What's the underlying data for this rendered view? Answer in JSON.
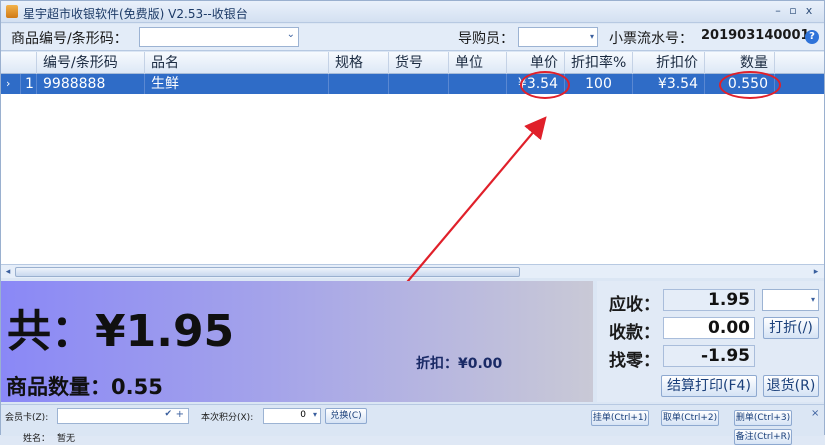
{
  "window": {
    "title": "星宇超市收银软件(免费版) V2.53--收银台",
    "controls": [
      "–",
      "▫",
      "x"
    ]
  },
  "toolbar": {
    "barcode_label": "商品编号/条形码：",
    "barcode_value": "",
    "salesperson_label": "导购员：",
    "salesperson_value": "",
    "receipt_label": "小票流水号：",
    "receipt_no": "201903140001",
    "help_icon": "?"
  },
  "grid": {
    "columns": [
      "编号/条形码",
      "品名",
      "规格",
      "货号",
      "单位",
      "单价",
      "折扣率%",
      "折扣价",
      "数量"
    ],
    "rows": [
      {
        "index": "1",
        "barcode": "9988888",
        "name": "生鲜",
        "spec": "",
        "sku": "",
        "unit": "",
        "price": "¥3.54",
        "discount_rate": "100",
        "discount_price": "¥3.54",
        "qty": "0.550"
      }
    ]
  },
  "totals": {
    "total_text": "共：¥1.95",
    "qty_text": "商品数量：0.55",
    "discount_text": "折扣：¥0.00"
  },
  "payment": {
    "due_label": "应收：",
    "due_value": "1.95",
    "paid_label": "收款：",
    "paid_value": "0.00",
    "change_label": "找零：",
    "change_value": "-1.95",
    "discount_button": "打折(/)",
    "checkout_button": "结算打印(F4)",
    "refund_button": "退货(R)"
  },
  "bottom": {
    "member_label": "会员卡(Z):",
    "points_label": "本次积分(X):",
    "points_value": "0",
    "exchange_button": "兑换(C)",
    "hang_button": "挂单(Ctrl+1)",
    "take_button": "取单(Ctrl+2)",
    "delete_button": "删单(Ctrl+3)",
    "next_button": "备注(Ctrl+R)",
    "name_label": "姓名：",
    "name_value": "暂无",
    "close_icon": "×"
  },
  "colors": {
    "selected_row": "#2f6cc7",
    "highlight_ring": "#e0202a",
    "panel_gradient_start": "#8a88f6"
  }
}
